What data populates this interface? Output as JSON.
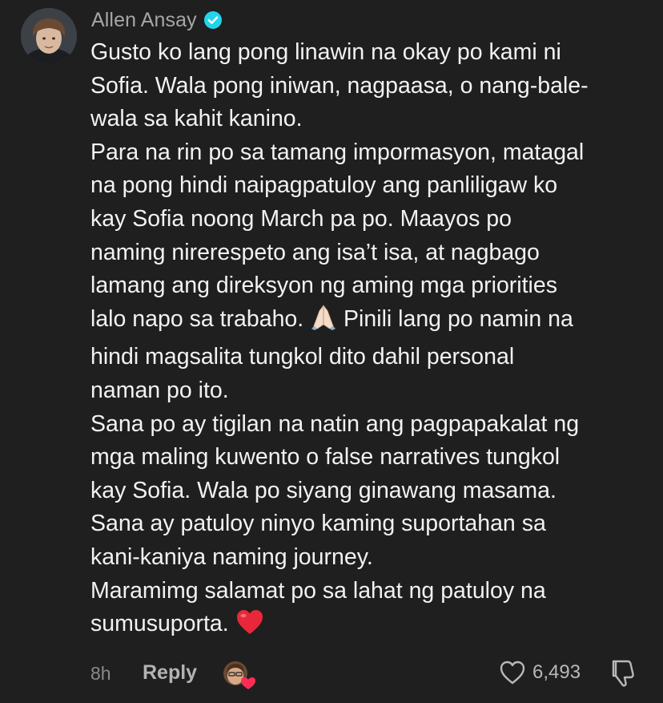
{
  "comment": {
    "username": "Allen Ansay",
    "verified_icon": "verified-badge-icon",
    "paragraphs": [
      {
        "lines": [
          "Gusto ko lang pong linawin na okay po kami ni",
          "Sofia. Wala pong iniwan, nagpaasa, o nang-bale-",
          "wala sa kahit kanino."
        ]
      },
      {
        "lines": [
          "Para na rin po sa tamang impormasyon, matagal",
          "na pong hindi naipagpatuloy ang panliligaw ko",
          "kay Sofia noong March pa po. Maayos po",
          "naming nirerespeto ang isa’t isa, at nagbago",
          "lamang ang direksyon ng aming mga priorities"
        ]
      },
      {
        "line_before_emoji": "lalo napo sa trabaho. ",
        "emoji": "folded-hands-emoji",
        "line_after_emoji": " Pinili lang po namin na",
        "lines": [
          "hindi magsalita tungkol dito dahil personal",
          "naman po ito."
        ]
      },
      {
        "lines": [
          "Sana po ay tigilan na natin ang pagpapakalat ng",
          "mga maling kuwento o false narratives tungkol",
          "kay Sofia. Wala po siyang ginawang masama.",
          "Sana ay patuloy ninyo kaming suportahan sa",
          "kani-kaniya naming journey.",
          "Maramimg salamat po sa lahat ng patuloy na"
        ]
      },
      {
        "line_before_emoji": "sumusuporta. ",
        "emoji": "red-heart-emoji"
      }
    ],
    "footer": {
      "timestamp": "8h",
      "reply_label": "Reply",
      "creator_liked_icon": "creator-liked-avatar-icon",
      "like_icon": "heart-outline-icon",
      "like_count": "6,493",
      "dislike_icon": "dislike-icon"
    }
  },
  "colors": {
    "background": "#1f1f1f",
    "text": "#f2f2f2",
    "muted": "#8a8a8a",
    "verified": "#20d5ec",
    "heart": "#e8283a"
  }
}
